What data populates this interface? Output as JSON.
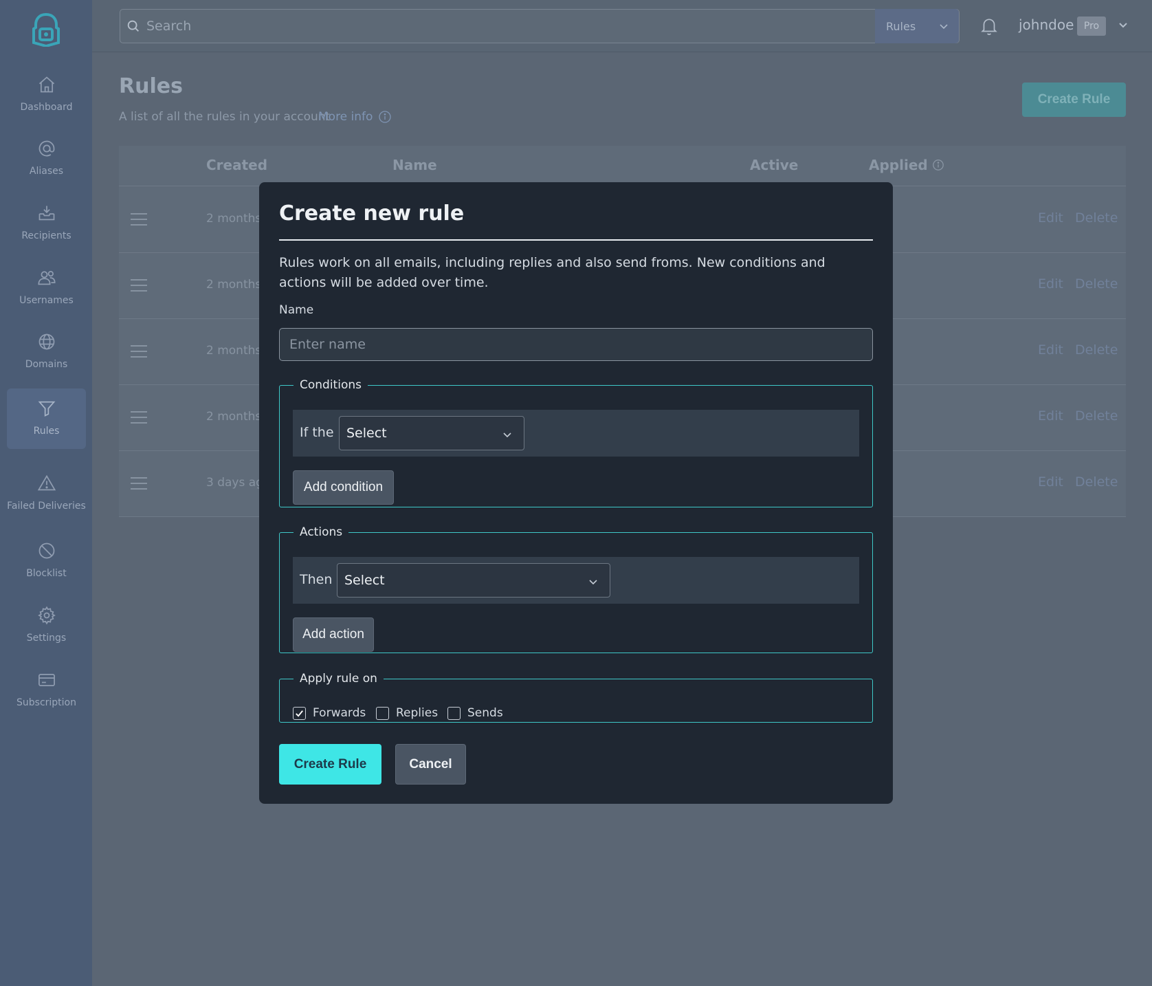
{
  "sidebar": {
    "items": [
      {
        "label": "Dashboard",
        "icon": "home-icon"
      },
      {
        "label": "Aliases",
        "icon": "at-sign-icon"
      },
      {
        "label": "Recipients",
        "icon": "inbox-download-icon"
      },
      {
        "label": "Usernames",
        "icon": "users-icon"
      },
      {
        "label": "Domains",
        "icon": "globe-icon"
      },
      {
        "label": "Rules",
        "icon": "filter-icon",
        "active": true
      },
      {
        "label": "Failed Deliveries",
        "icon": "warning-icon"
      },
      {
        "label": "Blocklist",
        "icon": "block-icon"
      },
      {
        "label": "Settings",
        "icon": "gear-icon"
      },
      {
        "label": "Subscription",
        "icon": "credit-card-icon"
      }
    ]
  },
  "topbar": {
    "search_placeholder": "Search",
    "search_scope": "Rules",
    "username": "johndoe",
    "plan_badge": "Pro"
  },
  "page": {
    "title": "Rules",
    "subtitle": "A list of all the rules in your account",
    "more_info": "More info",
    "create_button": "Create Rule"
  },
  "table": {
    "headers": {
      "created": "Created",
      "name": "Name",
      "active": "Active",
      "applied": "Applied"
    },
    "rows": [
      {
        "created": "2 months",
        "edit": "Edit",
        "delete": "Delete"
      },
      {
        "created": "2 months",
        "edit": "Edit",
        "delete": "Delete"
      },
      {
        "created": "2 months",
        "edit": "Edit",
        "delete": "Delete"
      },
      {
        "created": "2 months",
        "edit": "Edit",
        "delete": "Delete"
      },
      {
        "created": "3 days ag",
        "edit": "Edit",
        "delete": "Delete"
      }
    ]
  },
  "modal": {
    "title": "Create new rule",
    "description": "Rules work on all emails, including replies and also send froms. New conditions and actions will be added over time.",
    "name_label": "Name",
    "name_placeholder": "Enter name",
    "name_value": "",
    "conditions": {
      "legend": "Conditions",
      "row_label": "If the",
      "select_value": "Select",
      "add_button": "Add condition"
    },
    "actions": {
      "legend": "Actions",
      "row_label": "Then",
      "select_value": "Select",
      "add_button": "Add action"
    },
    "apply_on": {
      "legend": "Apply rule on",
      "options": [
        {
          "label": "Forwards",
          "checked": true
        },
        {
          "label": "Replies",
          "checked": false
        },
        {
          "label": "Sends",
          "checked": false
        }
      ]
    },
    "submit_button": "Create Rule",
    "cancel_button": "Cancel"
  },
  "colors": {
    "accent": "#3ee6e6",
    "sidebar_bg": "#4b5c75",
    "modal_bg": "#1f2732",
    "fieldset_border": "#3fc9c9"
  }
}
